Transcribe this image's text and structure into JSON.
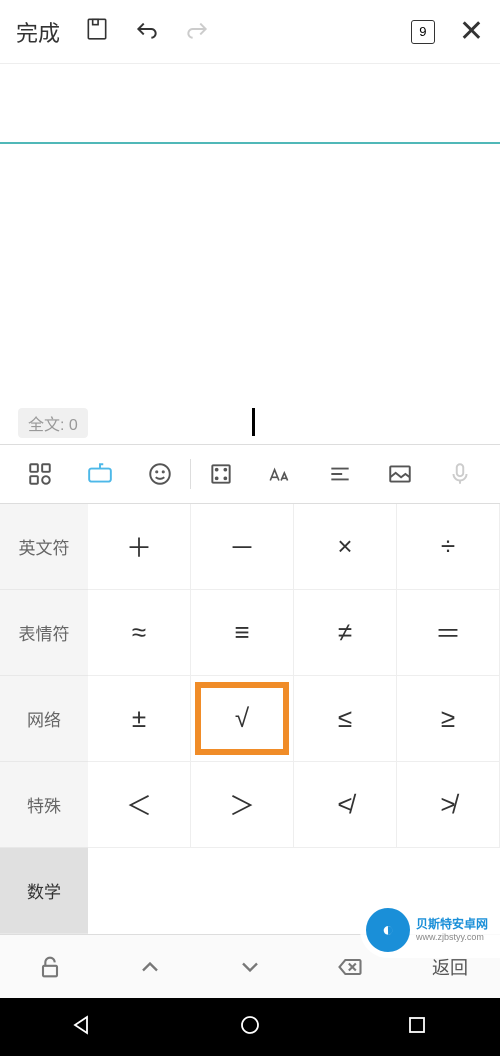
{
  "toolbar": {
    "done": "完成",
    "page_num": "9"
  },
  "editor": {
    "word_count": "全文: 0"
  },
  "categories": [
    {
      "label": "英文符",
      "active": false
    },
    {
      "label": "表情符",
      "active": false
    },
    {
      "label": "网络",
      "active": false
    },
    {
      "label": "特殊",
      "active": false
    },
    {
      "label": "数学",
      "active": true
    }
  ],
  "symbols": [
    "＋",
    "－",
    "×",
    "÷",
    "≈",
    "≡",
    "≠",
    "＝",
    "±",
    "√",
    "≤",
    "≥",
    "＜",
    "＞",
    "≮",
    "≯"
  ],
  "highlighted_index": 9,
  "bottom": {
    "return": "返回"
  },
  "watermark": {
    "brand": "贝斯特安卓网",
    "url": "www.zjbstyy.com"
  }
}
